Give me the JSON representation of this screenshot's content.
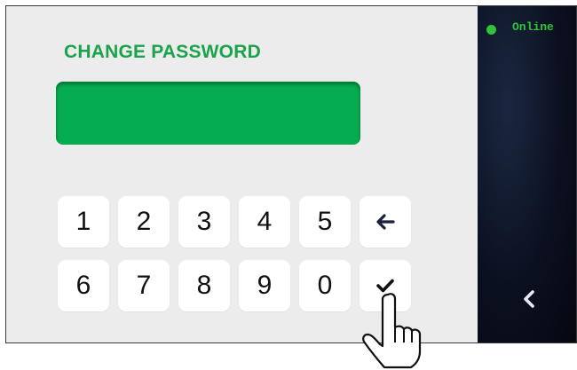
{
  "panel": {
    "title": "CHANGE PASSWORD",
    "password_value": ""
  },
  "keypad": {
    "row1": [
      "1",
      "2",
      "3",
      "4",
      "5"
    ],
    "row2": [
      "6",
      "7",
      "8",
      "9",
      "0"
    ]
  },
  "status": {
    "label": "Online",
    "color": "#2ec43b"
  },
  "icons": {
    "backspace": "arrow-left-icon",
    "confirm": "checkmark-icon",
    "back": "chevron-left-icon",
    "pointer": "hand-pointer-icon"
  },
  "colors": {
    "accent": "#06ad50",
    "title": "#1aa24c",
    "screen_background": "#ececec",
    "side_panel": "#0b1020"
  }
}
